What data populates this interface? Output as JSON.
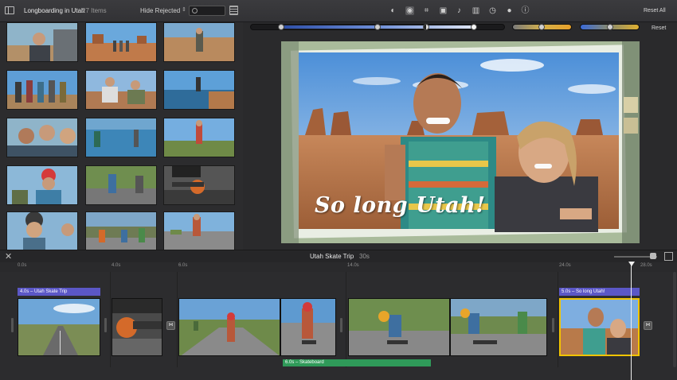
{
  "toolbar": {
    "library_title": "Longboarding in Utah",
    "library_count": "27 Items",
    "filter_label": "Hide Rejected",
    "reset_all_label": "Reset All"
  },
  "adjustments": {
    "reset_label": "Reset"
  },
  "viewer": {
    "title_overlay": "So long Utah!"
  },
  "timeline": {
    "project_title": "Utah Skate Trip",
    "project_duration": "30s",
    "ruler_ticks": [
      "0.0s",
      "4.0s",
      "6.0s",
      "14.0s",
      "24.0s",
      "28.0s"
    ],
    "title_clips": [
      "4.0s – Utah Skate Trip",
      "5.0s – So long Utah!"
    ],
    "audio_clip": "6.0s – Skateboard"
  },
  "colors": {
    "title_bar": "#5b57c6",
    "audio_bar": "#2f9a59",
    "selection": "#f2c400"
  }
}
